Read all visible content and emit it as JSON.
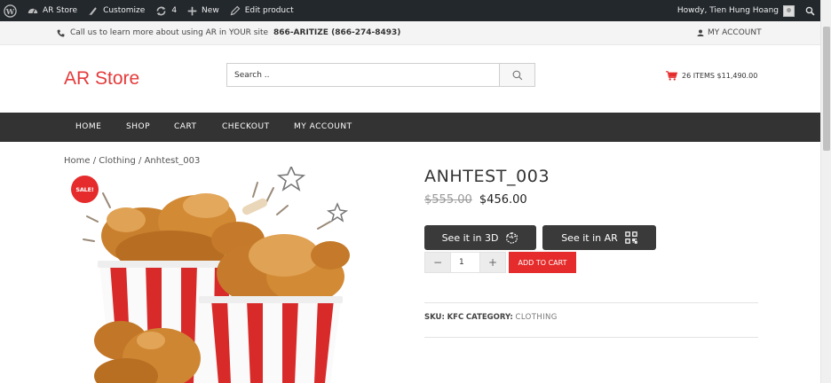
{
  "adminbar": {
    "site": "AR Store",
    "customize": "Customize",
    "updates": "4",
    "new": "New",
    "edit": "Edit product",
    "howdy": "Howdy, Tien Hung Hoang"
  },
  "topbar": {
    "call_text": "Call us to learn more about using AR in YOUR site",
    "phone": "866-ARITIZE (866-274-8493)",
    "account": "MY ACCOUNT"
  },
  "header": {
    "logo": "AR Store",
    "search_placeholder": "Search ..",
    "cart_summary": "26 ITEMS $11,490.00"
  },
  "nav": [
    "HOME",
    "SHOP",
    "CART",
    "CHECKOUT",
    "MY ACCOUNT"
  ],
  "breadcrumb": "Home / Clothing / Anhtest_003",
  "product": {
    "sale_badge": "SALE!",
    "title": "ANHTEST_003",
    "old_price": "$555.00",
    "price": "$456.00",
    "btn_3d": "See it in 3D",
    "btn_ar": "See it in AR",
    "quantity": "1",
    "minus": "−",
    "plus": "+",
    "add_to_cart": "ADD TO CART",
    "sku_label": "SKU:",
    "sku": "KFC",
    "category_label": "CATEGORY:",
    "category": "CLOTHING"
  },
  "colors": {
    "accent": "#e52b2b",
    "nav_bg": "#333333",
    "adminbar_bg": "#23282d"
  }
}
